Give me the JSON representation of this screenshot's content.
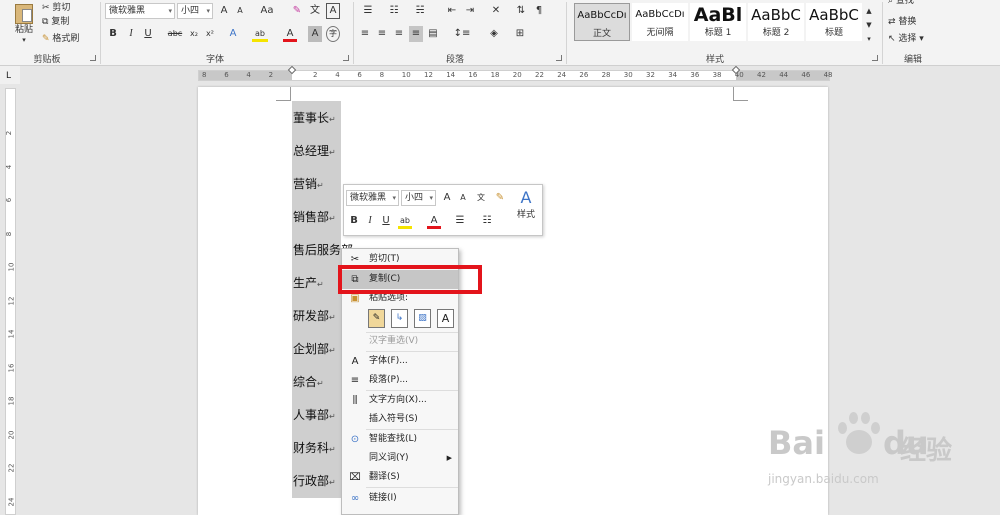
{
  "ribbon": {
    "clipboard": {
      "paste": "粘贴",
      "cut": "剪切",
      "copy": "复制",
      "format_painter": "格式刷",
      "group": "剪贴板"
    },
    "font": {
      "font_name": "微软雅黑",
      "font_size": "小四",
      "group": "字体",
      "grow": "A",
      "shrink": "A",
      "case": "Aa",
      "phonetic": "文",
      "bold": "B",
      "italic": "I",
      "underline": "U",
      "strike": "abc",
      "sub": "x₂",
      "sup": "x²",
      "effects": "A",
      "color": "A",
      "shade": "A",
      "enclose": "字"
    },
    "paragraph": {
      "group": "段落"
    },
    "styles": {
      "group": "样式",
      "items": [
        {
          "preview": "AaBbCcDı",
          "name": "正文"
        },
        {
          "preview": "AaBbCcDı",
          "name": "无间隔"
        },
        {
          "preview": "AaBl",
          "name": "标题 1"
        },
        {
          "preview": "AaBbC",
          "name": "标题 2"
        },
        {
          "preview": "AaBbC",
          "name": "标题"
        }
      ]
    },
    "editing": {
      "find": "查找",
      "replace": "替换",
      "select": "选择",
      "group": "编辑"
    }
  },
  "ruler": {
    "h_ticks": [
      "8",
      "6",
      "4",
      "2",
      "",
      "2",
      "4",
      "6",
      "8",
      "10",
      "12",
      "14",
      "16",
      "18",
      "20",
      "22",
      "24",
      "26",
      "28",
      "30",
      "32",
      "34",
      "36",
      "38",
      "40",
      "42",
      "44",
      "46",
      "48"
    ],
    "v_ticks": [
      "2",
      "4",
      "6",
      "8",
      "10",
      "12",
      "14",
      "16",
      "18",
      "20",
      "22",
      "24"
    ]
  },
  "document": {
    "lines": [
      "董事长",
      "总经理",
      "营销",
      "销售部",
      "售后服务部",
      "生产",
      "研发部",
      "企划部",
      "综合",
      "人事部",
      "财务科",
      "行政部"
    ],
    "mark": "↵"
  },
  "mini_toolbar": {
    "font_name": "微软雅黑",
    "font_size": "小四",
    "bold": "B",
    "italic": "I",
    "underline": "U",
    "styles": "样式"
  },
  "context_menu": {
    "cut": "剪切(T)",
    "copy": "复制(C)",
    "paste_options": "粘贴选项:",
    "reconvert": "汉字重选(V)",
    "font": "字体(F)...",
    "paragraph": "段落(P)...",
    "text_direction": "文字方向(X)...",
    "insert_symbol": "插入符号(S)",
    "smart_lookup": "智能查找(L)",
    "synonyms": "同义词(Y)",
    "translate": "翻译(S)",
    "link": "链接(I)"
  },
  "watermark": {
    "brand": "Bai",
    "brand2": "du",
    "cn": "经验",
    "url": "jingyan.baidu.com"
  },
  "colors": {
    "highlight": "#e3141b",
    "font_red": "#e3141b",
    "selection": "#cfcfcf"
  }
}
